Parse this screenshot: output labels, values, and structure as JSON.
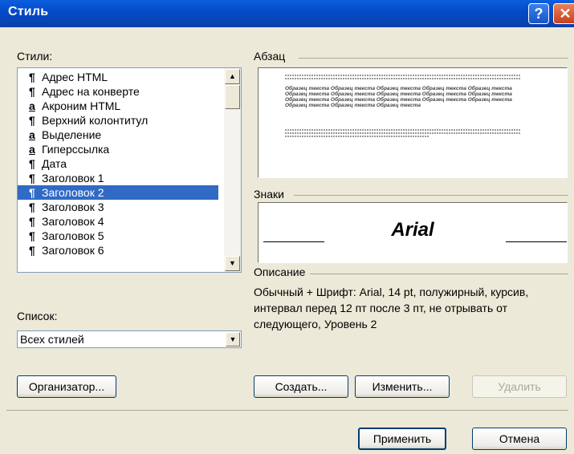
{
  "window": {
    "title": "Стиль",
    "help_label": "?",
    "close_label": "✕"
  },
  "styles": {
    "label": "Стили:",
    "items": [
      {
        "icon": "¶",
        "icon_name": "paragraph-style-icon",
        "label": "Адрес HTML"
      },
      {
        "icon": "¶",
        "icon_name": "paragraph-style-icon",
        "label": "Адрес на конверте"
      },
      {
        "icon": "a",
        "icon_name": "character-style-icon",
        "label": "Акроним HTML"
      },
      {
        "icon": "¶",
        "icon_name": "paragraph-style-icon",
        "label": "Верхний колонтитул"
      },
      {
        "icon": "a",
        "icon_name": "character-style-icon",
        "label": "Выделение"
      },
      {
        "icon": "a",
        "icon_name": "character-style-icon",
        "label": "Гиперссылка"
      },
      {
        "icon": "¶",
        "icon_name": "paragraph-style-icon",
        "label": "Дата"
      },
      {
        "icon": "¶",
        "icon_name": "paragraph-style-icon",
        "label": "Заголовок 1"
      },
      {
        "icon": "¶",
        "icon_name": "paragraph-style-icon",
        "label": "Заголовок 2",
        "selected": true
      },
      {
        "icon": "¶",
        "icon_name": "paragraph-style-icon",
        "label": "Заголовок 3"
      },
      {
        "icon": "¶",
        "icon_name": "paragraph-style-icon",
        "label": "Заголовок 4"
      },
      {
        "icon": "¶",
        "icon_name": "paragraph-style-icon",
        "label": "Заголовок 5"
      },
      {
        "icon": "¶",
        "icon_name": "paragraph-style-icon",
        "label": "Заголовок 6"
      }
    ],
    "scroll_up": "▲",
    "scroll_down": "▼"
  },
  "paragraph": {
    "label": "Абзац",
    "sample_text": "Образец текста Образец текста Образец текста Образец текста Образец текста Образец текста Образец текста Образец текста Образец текста Образец текста Образец текста Образец текста Образец текста Образец текста Образец текста Образец текста Образец текста Образец текста"
  },
  "characters": {
    "label": "Знаки",
    "font_sample": "Arial"
  },
  "description": {
    "label": "Описание",
    "text": "Обычный + Шрифт: Arial, 14 pt, полужирный, курсив, интервал перед 12 пт  после 3 пт, не отрывать от следующего, Уровень 2"
  },
  "list": {
    "label": "Список:",
    "value": "Всех стилей",
    "arrow": "▼"
  },
  "buttons": {
    "organizer": "Организатор...",
    "create": "Создать...",
    "modify": "Изменить...",
    "delete": "Удалить",
    "apply": "Применить",
    "cancel": "Отмена"
  },
  "colors": {
    "titlebar": "#0549c7",
    "selection": "#316ac5",
    "dialog_bg": "#ece9d8"
  }
}
